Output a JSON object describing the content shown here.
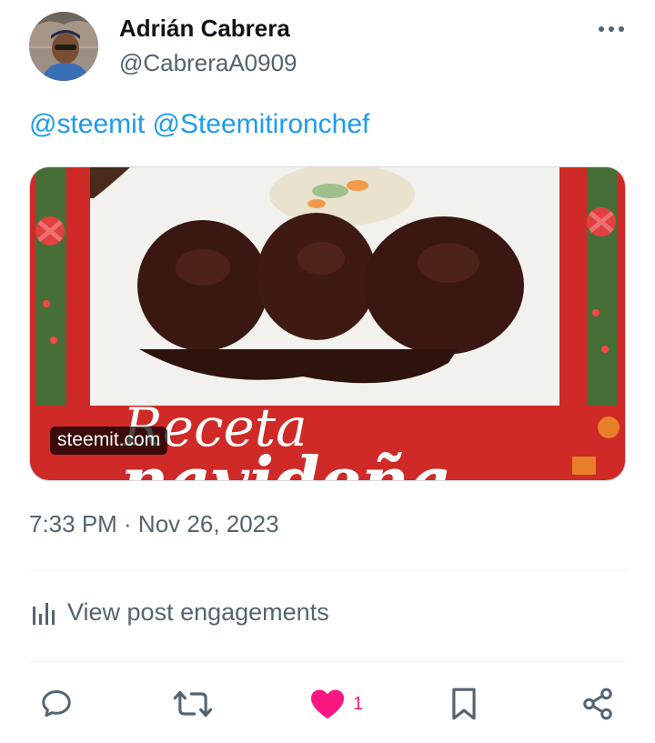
{
  "author": {
    "name": "Adrián Cabrera",
    "handle": "@CabreraA0909"
  },
  "tweet": {
    "mentions": [
      "@steemit",
      "@Steemitironchef"
    ],
    "card": {
      "domain": "steemit.com",
      "overlay_text_line1": "Receta",
      "overlay_text_line2": "navideña"
    },
    "timestamp": "7:33 PM · Nov 26, 2023"
  },
  "engagements_label": "View post engagements",
  "actions": {
    "reply_icon": "reply-icon",
    "retweet_icon": "retweet-icon",
    "like_icon": "heart-icon",
    "like_count": "1",
    "bookmark_icon": "bookmark-icon",
    "share_icon": "share-icon"
  },
  "colors": {
    "accent": "#1d9bf0",
    "like": "#f91880",
    "secondary_text": "#536471"
  }
}
